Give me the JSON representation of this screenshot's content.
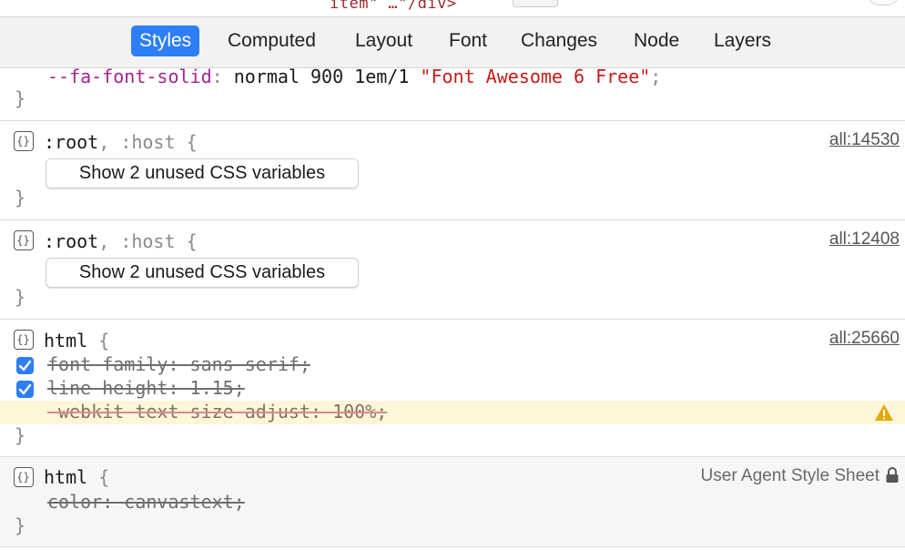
{
  "colors": {
    "accent": "#2d7ef7",
    "property": "#a3238f",
    "string": "#c41a16",
    "warning_bg": "#fdf6d8",
    "warning_icon": "#e5a800"
  },
  "top_strip": {
    "dom_fragment": "item\" …\"/div>",
    "dom_fragment2": "</div>"
  },
  "tabs": [
    {
      "label": "Styles",
      "active": true
    },
    {
      "label": "Computed"
    },
    {
      "label": "Layout"
    },
    {
      "label": "Font"
    },
    {
      "label": "Changes"
    },
    {
      "label": "Node"
    },
    {
      "label": "Layers"
    }
  ],
  "rule0": {
    "property": "--fa-font-solid",
    "value": "normal 900 1em/1 ",
    "string": "\"Font Awesome 6 Free\"",
    "close": "}"
  },
  "rule1": {
    "icon": "rule-icon",
    "selector_a": ":root",
    "selector_sep": ", ",
    "selector_b": ":host",
    "open": "{",
    "button": "Show 2 unused CSS variables",
    "close": "}",
    "source": "all:14530"
  },
  "rule2": {
    "icon": "rule-icon",
    "selector_a": ":root",
    "selector_sep": ", ",
    "selector_b": ":host",
    "open": "{",
    "button": "Show 2 unused CSS variables",
    "close": "}",
    "source": "all:12408"
  },
  "rule3": {
    "icon": "rule-icon",
    "selector": "html",
    "open": "{",
    "source": "all:25660",
    "declarations": [
      {
        "text": "font-family: sans-serif;",
        "checked": true
      },
      {
        "text": "line-height: 1.15;",
        "checked": true
      },
      {
        "text": "-webkit-text-size-adjust: 100%;",
        "warning": true
      }
    ],
    "close": "}"
  },
  "rule4": {
    "icon": "rule-icon",
    "selector": "html",
    "open": "{",
    "source": "User Agent Style Sheet",
    "lock_icon": "lock-icon",
    "declarations": [
      {
        "text": "color: canvastext;"
      }
    ],
    "close": "}"
  }
}
